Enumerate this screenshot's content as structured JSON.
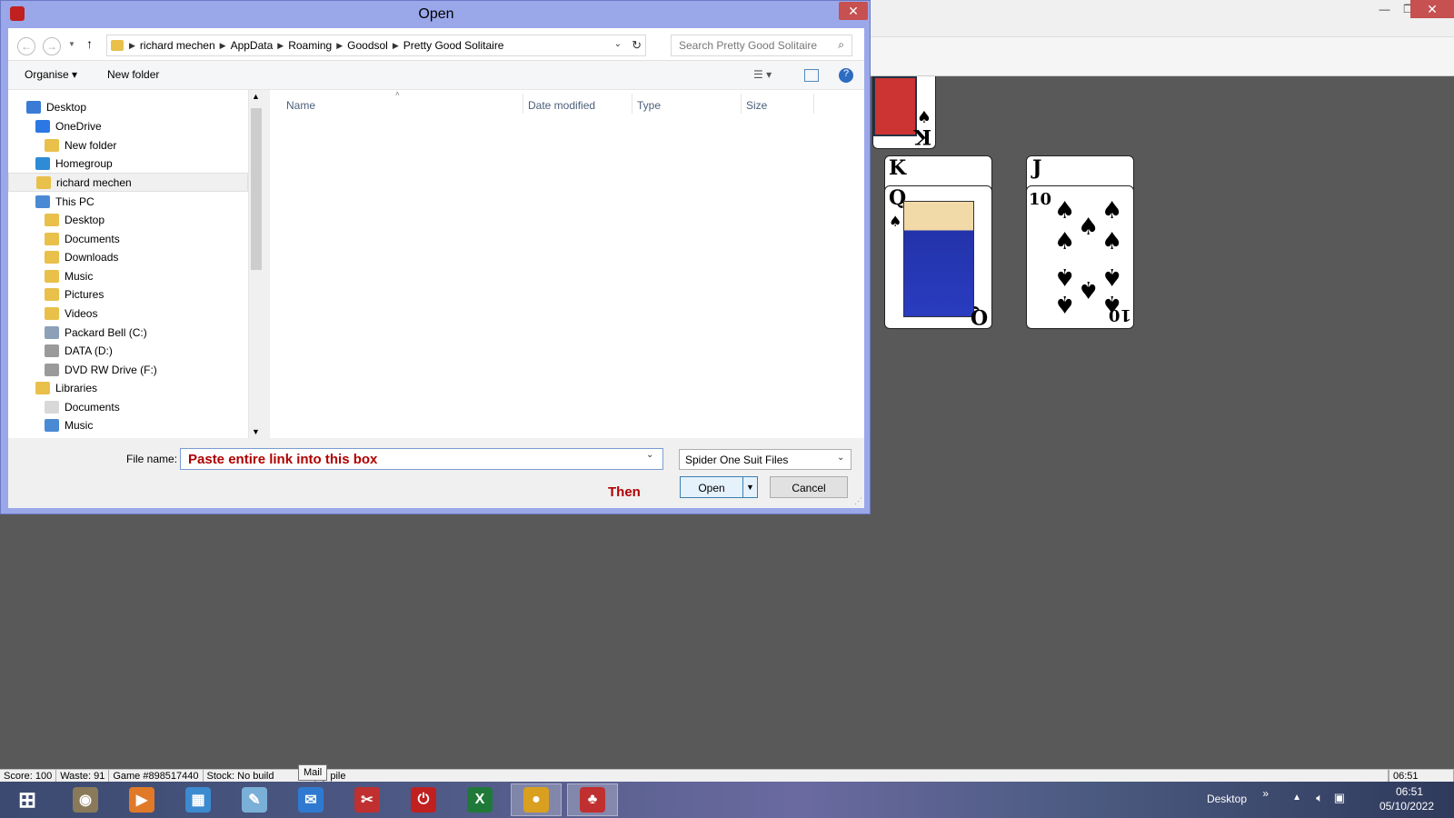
{
  "dialog": {
    "title": "Open",
    "close_glyph": "✕",
    "address": {
      "crumbs": [
        "richard mechen",
        "AppData",
        "Roaming",
        "Goodsol",
        "Pretty Good Solitaire"
      ]
    },
    "search_placeholder": "Search Pretty Good Solitaire",
    "commands": {
      "organise": "Organise ▾",
      "new_folder": "New folder"
    },
    "nav": [
      {
        "label": "Desktop",
        "icon": "desktop-icon",
        "color": "#3a7bd5",
        "indent": 0
      },
      {
        "label": "OneDrive",
        "icon": "onedrive-icon",
        "color": "#2b78e4",
        "indent": 1
      },
      {
        "label": "New folder",
        "icon": "folder-icon",
        "color": "#e8c04a",
        "indent": 2
      },
      {
        "label": "Homegroup",
        "icon": "homegroup-icon",
        "color": "#2e8bd6",
        "indent": 1
      },
      {
        "label": "richard mechen",
        "icon": "user-folder-icon",
        "color": "#e8c04a",
        "indent": 1
      },
      {
        "label": "This PC",
        "icon": "computer-icon",
        "color": "#4a8ad4",
        "indent": 1
      },
      {
        "label": "Desktop",
        "icon": "folder-icon",
        "color": "#e8c04a",
        "indent": 2
      },
      {
        "label": "Documents",
        "icon": "documents-icon",
        "color": "#e8c04a",
        "indent": 2
      },
      {
        "label": "Downloads",
        "icon": "downloads-icon",
        "color": "#e8c04a",
        "indent": 2
      },
      {
        "label": "Music",
        "icon": "music-icon",
        "color": "#e8c04a",
        "indent": 2
      },
      {
        "label": "Pictures",
        "icon": "pictures-icon",
        "color": "#e8c04a",
        "indent": 2
      },
      {
        "label": "Videos",
        "icon": "videos-icon",
        "color": "#e8c04a",
        "indent": 2
      },
      {
        "label": "Packard Bell (C:)",
        "icon": "drive-c-icon",
        "color": "#8ca0b8",
        "indent": 2
      },
      {
        "label": "DATA (D:)",
        "icon": "drive-icon",
        "color": "#9a9a9a",
        "indent": 2
      },
      {
        "label": "DVD RW Drive (F:)",
        "icon": "dvd-drive-icon",
        "color": "#9a9a9a",
        "indent": 2
      },
      {
        "label": "Libraries",
        "icon": "libraries-icon",
        "color": "#e8c04a",
        "indent": 1
      },
      {
        "label": "Documents",
        "icon": "documents-icon",
        "color": "#d8d8d8",
        "indent": 2
      },
      {
        "label": "Music",
        "icon": "music-icon",
        "color": "#4a8ad4",
        "indent": 2
      }
    ],
    "columns": [
      "Name",
      "Date modified",
      "Type",
      "Size"
    ],
    "file_name_label": "File name:",
    "file_name_value": "Paste entire link into this box",
    "file_type": "Spider One Suit Files",
    "then_text": "Then",
    "open_label": "Open",
    "cancel_label": "Cancel"
  },
  "cards": [
    {
      "rank": "K",
      "pip": "♠"
    },
    {
      "rank": "K",
      "pip": "♠"
    },
    {
      "rank": "Q",
      "pip": "♠"
    },
    {
      "rank": "J",
      "pip": "♠"
    },
    {
      "rank": "10",
      "pip": "♠"
    }
  ],
  "statusbar": {
    "score": "Score:  100",
    "waste": "Waste:  91",
    "game": "Game #898517440",
    "stock": "Stock: No build",
    "stock_rest": "npty pile",
    "time": "06:51"
  },
  "tooltip": "Mail",
  "window_controls": {
    "minimize": "—",
    "restore": "❐",
    "close": "✕"
  },
  "taskbar": {
    "items": [
      {
        "name": "start-button",
        "glyph": "⊞",
        "color": "#ffffff"
      },
      {
        "name": "gimp-icon",
        "glyph": "◉",
        "color": "#8a7a5a"
      },
      {
        "name": "media-player-icon",
        "glyph": "▶",
        "color": "#e07a28"
      },
      {
        "name": "control-panel-icon",
        "glyph": "▦",
        "color": "#3c8ad0"
      },
      {
        "name": "paint-icon",
        "glyph": "✎",
        "color": "#7ab0d8"
      },
      {
        "name": "mail-icon",
        "glyph": "✉",
        "color": "#2f7ad0"
      },
      {
        "name": "snipping-tool-icon",
        "glyph": "✂",
        "color": "#c03030"
      },
      {
        "name": "power-icon",
        "glyph": "⏻",
        "color": "#c02020"
      },
      {
        "name": "excel-icon",
        "glyph": "X",
        "color": "#1f7a3a"
      },
      {
        "name": "chrome-icon",
        "glyph": "●",
        "color": "#d9a020"
      },
      {
        "name": "solitaire-app-icon",
        "glyph": "♣",
        "color": "#c03030"
      }
    ],
    "tray": {
      "desktop_label": "Desktop",
      "chevron": "»",
      "time": "06:51",
      "date": "05/10/2022"
    }
  }
}
